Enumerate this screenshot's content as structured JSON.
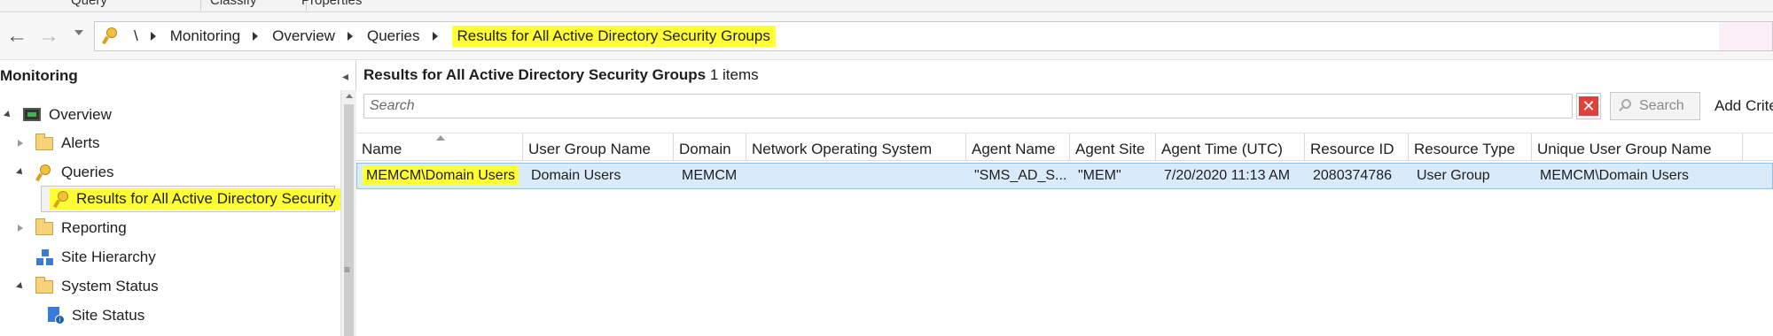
{
  "ribbon": {
    "tabs": [
      "Query",
      "Classify",
      "Properties"
    ]
  },
  "navigation": {
    "breadcrumb": [
      "\\",
      "Monitoring",
      "Overview",
      "Queries",
      "Results for All Active Directory Security Groups"
    ]
  },
  "left_pane": {
    "title": "Monitoring",
    "tree": [
      {
        "label": "Overview",
        "icon": "monitor-icon",
        "expanded": true
      },
      {
        "label": "Alerts",
        "icon": "folder-icon",
        "expanded": false
      },
      {
        "label": "Queries",
        "icon": "query-key-icon",
        "expanded": true
      },
      {
        "label": "Results for All Active Directory Security G",
        "icon": "query-key-icon",
        "selected": true,
        "highlighted": true
      },
      {
        "label": "Reporting",
        "icon": "folder-icon",
        "expanded": false
      },
      {
        "label": "Site Hierarchy",
        "icon": "site-hierarchy-icon"
      },
      {
        "label": "System Status",
        "icon": "folder-icon",
        "expanded": true
      },
      {
        "label": "Site Status",
        "icon": "site-status-icon"
      }
    ]
  },
  "right_pane": {
    "title": "Results for All Active Directory Security Groups",
    "item_count": "1 items",
    "search_placeholder": "Search",
    "search_button": "Search",
    "add_criteria": "Add Crite",
    "columns": [
      "Name",
      "User Group Name",
      "Domain",
      "Network Operating System",
      "Agent Name",
      "Agent Site",
      "Agent Time (UTC)",
      "Resource ID",
      "Resource Type",
      "Unique User Group Name"
    ],
    "rows": [
      [
        "MEMCM\\Domain Users",
        "Domain Users",
        "MEMCM",
        "",
        "\"SMS_AD_S...",
        "\"MEM\"",
        "7/20/2020 11:13 AM",
        "2080374786",
        "User Group",
        "MEMCM\\Domain Users"
      ]
    ]
  },
  "colors": {
    "highlight": "#ffff33",
    "selection": "#d9ebfb",
    "accent": "#3a7bd5"
  }
}
